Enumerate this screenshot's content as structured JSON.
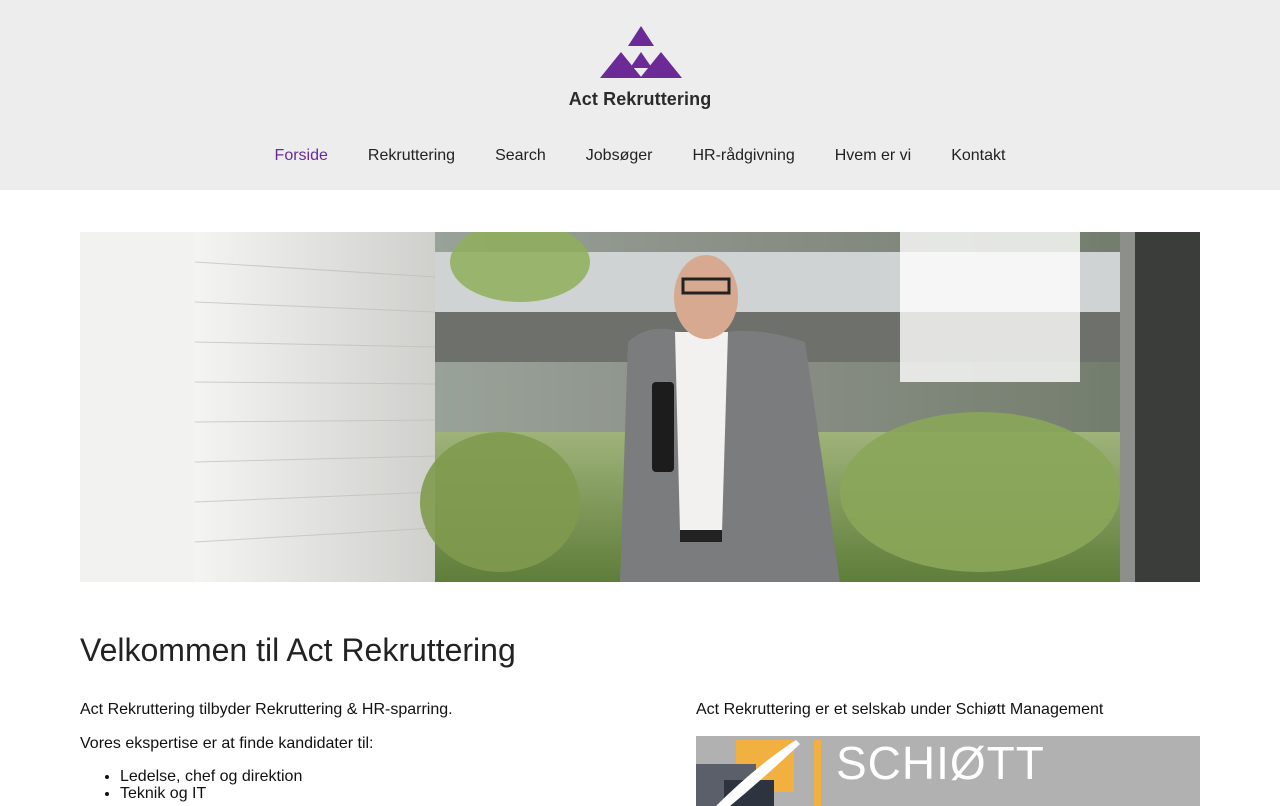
{
  "brand": {
    "name": "Act Rekruttering",
    "logo_icon": "triangles-logo-icon",
    "accent_color": "#6b2a96"
  },
  "nav": {
    "items": [
      {
        "label": "Forside",
        "active": true
      },
      {
        "label": "Rekruttering",
        "active": false
      },
      {
        "label": "Search",
        "active": false
      },
      {
        "label": "Jobsøger",
        "active": false
      },
      {
        "label": "HR-rådgivning",
        "active": false
      },
      {
        "label": "Hvem er vi",
        "active": false
      },
      {
        "label": "Kontakt",
        "active": false
      }
    ]
  },
  "hero": {
    "image": "hero-photo-man-in-suit"
  },
  "main": {
    "title": "Velkommen til Act Rekruttering",
    "intro": "Act Rekruttering tilbyder Rekruttering & HR-sparring.",
    "expertise_heading": "Vores ekspertise er at finde kandidater til:",
    "expertise_list": [
      "Ledelse, chef og direktion",
      "Teknik og IT"
    ]
  },
  "sidebar": {
    "parent_text": "Act Rekruttering er et selskab under Schiøtt Management",
    "partner_logo_text": "SCHIØTT"
  }
}
